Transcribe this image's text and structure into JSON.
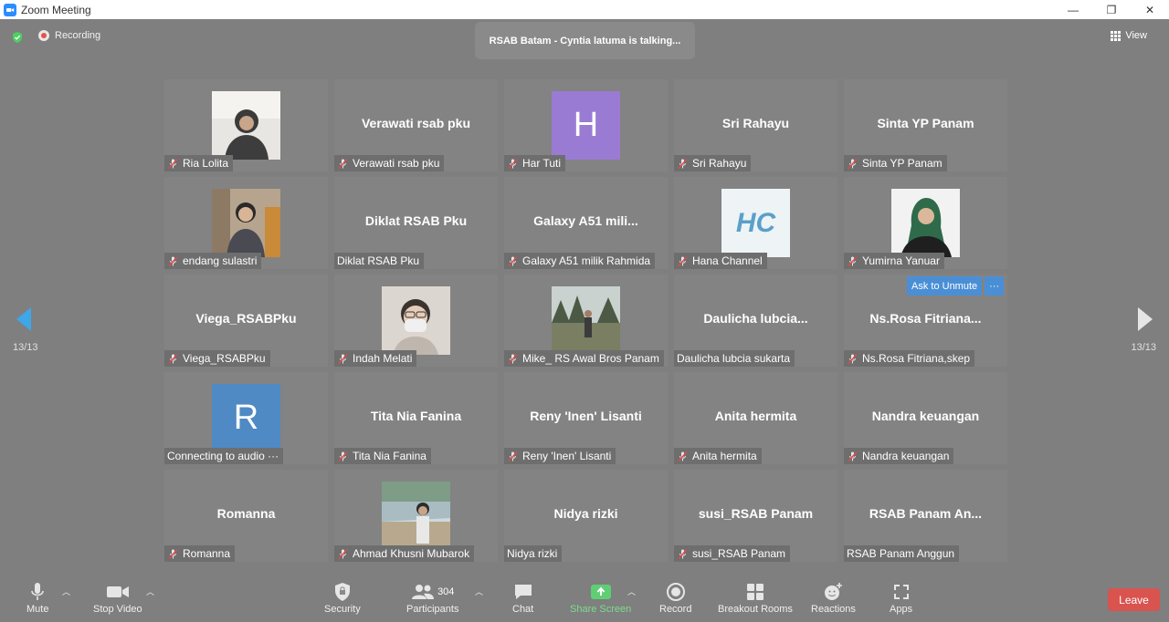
{
  "window": {
    "title": "Zoom Meeting",
    "minimize": "—",
    "restore": "❐",
    "close": "✕"
  },
  "topbar": {
    "recording": "Recording",
    "talking": "RSAB Batam - Cyntia latuma is talking...",
    "view": "View"
  },
  "pager": {
    "left_count": "13/13",
    "right_count": "13/13"
  },
  "ask": {
    "ask_to_unmute": "Ask to Unmute",
    "more": "···"
  },
  "tiles": [
    {
      "name": "",
      "label": "Ria Lolita",
      "muted": true
    },
    {
      "name": "Verawati rsab pku",
      "label": "Verawati rsab pku",
      "muted": true
    },
    {
      "name": "",
      "label": "Har Tuti",
      "muted": true,
      "letter": "H"
    },
    {
      "name": "Sri Rahayu",
      "label": "Sri Rahayu",
      "muted": true
    },
    {
      "name": "Sinta YP Panam",
      "label": "Sinta YP Panam",
      "muted": true
    },
    {
      "name": "",
      "label": "endang sulastri",
      "muted": true
    },
    {
      "name": "Diklat RSAB Pku",
      "label": "Diklat RSAB Pku",
      "muted": false
    },
    {
      "name": "Galaxy A51 mili...",
      "label": "Galaxy A51 milik Rahmida",
      "muted": true
    },
    {
      "name": "",
      "label": "Hana Channel",
      "muted": true,
      "logo": "HC"
    },
    {
      "name": "",
      "label": "Yumirna Yanuar",
      "muted": true
    },
    {
      "name": "Viega_RSABPku",
      "label": "Viega_RSABPku",
      "muted": true
    },
    {
      "name": "",
      "label": "Indah Melati",
      "muted": true
    },
    {
      "name": "",
      "label": "Mike_ RS Awal Bros Panam",
      "muted": true
    },
    {
      "name": "Daulicha  lubcia...",
      "label": "Daulicha lubcia sukarta",
      "muted": false
    },
    {
      "name": "Ns.Rosa  Fitriana...",
      "label": "Ns.Rosa Fitriana,skep",
      "muted": true
    },
    {
      "name": "",
      "label": "Connecting to audio ···",
      "muted": false,
      "letter": "R"
    },
    {
      "name": "Tita Nia Fanina",
      "label": "Tita Nia Fanina",
      "muted": true
    },
    {
      "name": "Reny 'Inen' Lisanti",
      "label": "Reny 'Inen' Lisanti",
      "muted": true
    },
    {
      "name": "Anita hermita",
      "label": "Anita hermita",
      "muted": true
    },
    {
      "name": "Nandra keuangan",
      "label": "Nandra keuangan",
      "muted": true
    },
    {
      "name": "Romanna",
      "label": "Romanna",
      "muted": true
    },
    {
      "name": "",
      "label": "Ahmad Khusni Mubarok",
      "muted": true
    },
    {
      "name": "Nidya rizki",
      "label": "Nidya rizki",
      "muted": false
    },
    {
      "name": "susi_RSAB Panam",
      "label": "susi_RSAB Panam",
      "muted": true
    },
    {
      "name": "RSAB Panam An...",
      "label": "RSAB Panam Anggun",
      "muted": false
    }
  ],
  "toolbar": {
    "mute": "Mute",
    "stop_video": "Stop Video",
    "security": "Security",
    "participants": "Participants",
    "participant_count": "304",
    "chat": "Chat",
    "share_screen": "Share Screen",
    "record": "Record",
    "breakout_rooms": "Breakout Rooms",
    "reactions": "Reactions",
    "apps": "Apps",
    "leave": "Leave"
  },
  "colors": {
    "accent_blue": "#4a8fd6",
    "share_green": "#7ddc8e",
    "leave_red": "#d9534f",
    "avatar_purple": "#9a7bd4",
    "avatar_blue": "#4f8ac4"
  }
}
